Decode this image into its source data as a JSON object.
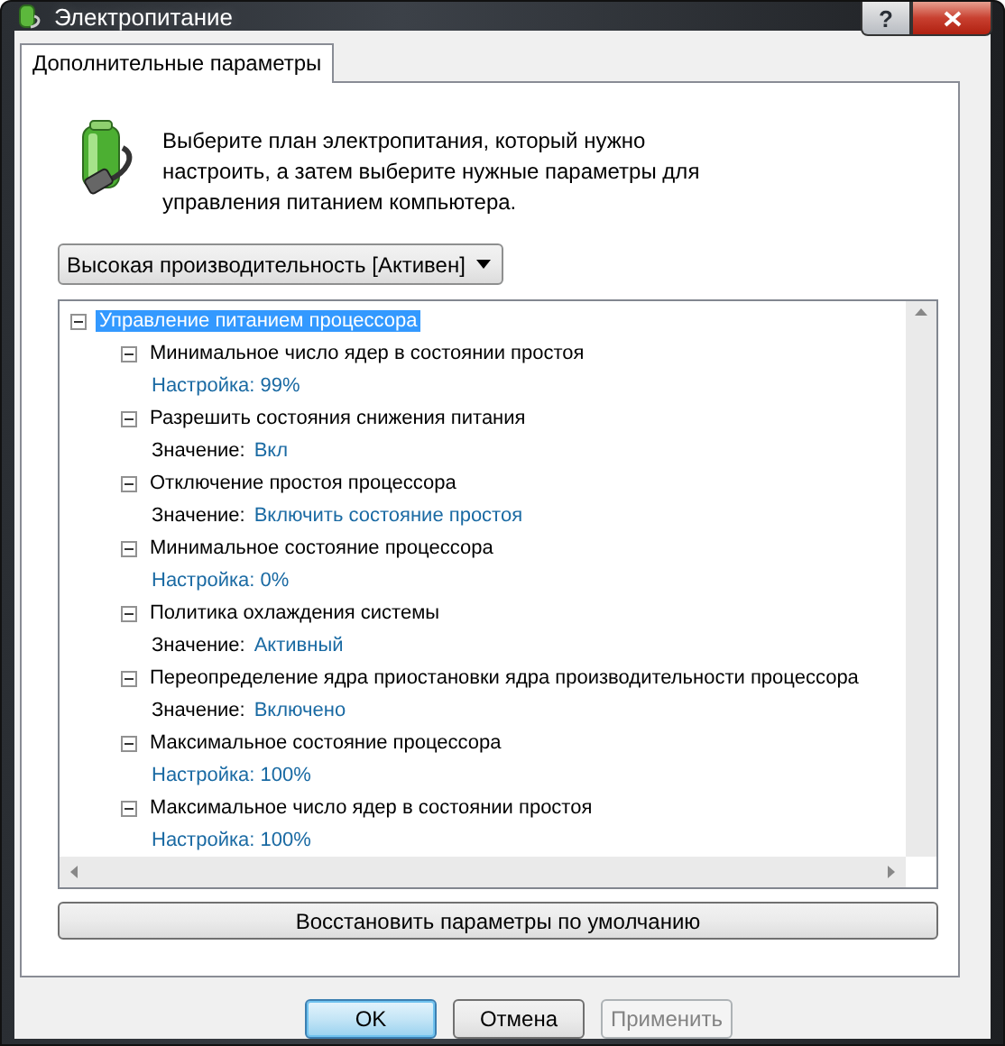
{
  "window": {
    "title": "Электропитание",
    "help": "?"
  },
  "tabs": [
    {
      "label": "Дополнительные параметры",
      "selected": true
    }
  ],
  "intro": "Выберите план электропитания, который нужно настроить, а затем выберите нужные параметры для управления питанием компьютера.",
  "plan_dropdown": {
    "value": "Высокая производительность [Активен]"
  },
  "tree": [
    {
      "label": "Управление питанием процессора",
      "expanded": true,
      "selected": true,
      "children": [
        {
          "label": "Минимальное число ядер в состоянии простоя",
          "expanded": true,
          "selected": false,
          "setting": {
            "kind": "setting",
            "text": "Настройка: 99%"
          }
        },
        {
          "label": "Разрешить состояния снижения питания",
          "expanded": true,
          "selected": false,
          "setting": {
            "kind": "value",
            "label": "Значение:",
            "value": "Вкл"
          }
        },
        {
          "label": "Отключение простоя процессора",
          "expanded": true,
          "selected": false,
          "setting": {
            "kind": "value",
            "label": "Значение:",
            "value": "Включить состояние простоя"
          }
        },
        {
          "label": "Минимальное состояние процессора",
          "expanded": true,
          "selected": false,
          "setting": {
            "kind": "setting",
            "text": "Настройка: 0%"
          }
        },
        {
          "label": "Политика охлаждения системы",
          "expanded": true,
          "selected": false,
          "setting": {
            "kind": "value",
            "label": "Значение:",
            "value": "Активный"
          }
        },
        {
          "label": "Переопределение ядра приостановки ядра производительности процессора",
          "expanded": true,
          "selected": false,
          "setting": {
            "kind": "value",
            "label": "Значение:",
            "value": "Включено"
          }
        },
        {
          "label": "Максимальное состояние процессора",
          "expanded": true,
          "selected": false,
          "setting": {
            "kind": "setting",
            "text": "Настройка: 100%"
          }
        },
        {
          "label": "Максимальное число ядер в состоянии простоя",
          "expanded": true,
          "selected": false,
          "setting": {
            "kind": "setting",
            "text": "Настройка: 100%"
          }
        }
      ]
    }
  ],
  "restore_button": "Восстановить параметры по умолчанию",
  "buttons": [
    {
      "label": "OK",
      "kind": "default",
      "disabled": false
    },
    {
      "label": "Отмена",
      "kind": "normal",
      "disabled": false
    },
    {
      "label": "Применить",
      "kind": "normal",
      "disabled": true
    }
  ]
}
